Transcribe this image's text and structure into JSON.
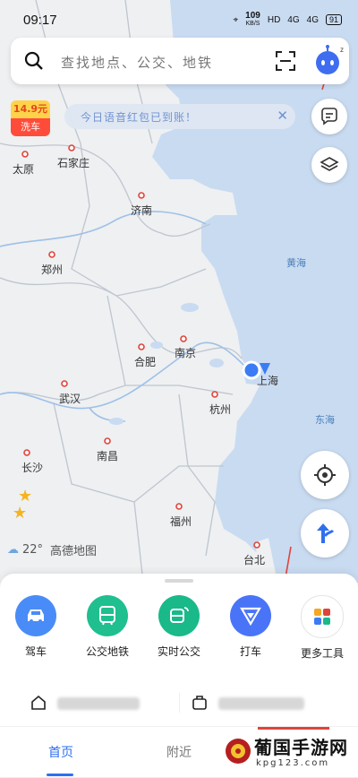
{
  "status_bar": {
    "time": "09:17",
    "net_speed_value": "109",
    "net_speed_unit": "KB/S",
    "hd": "HD",
    "sig1": "4G",
    "sig2": "4G",
    "battery": "91"
  },
  "search": {
    "placeholder": "查找地点、公交、地铁"
  },
  "promo": {
    "price": "14.9元",
    "label": "洗车"
  },
  "notice": {
    "text": "今日语音红包已到账！"
  },
  "map": {
    "cities": [
      {
        "name": "太原"
      },
      {
        "name": "石家庄"
      },
      {
        "name": "济南"
      },
      {
        "name": "郑州"
      },
      {
        "name": "合肥"
      },
      {
        "name": "南京"
      },
      {
        "name": "武汉"
      },
      {
        "name": "杭州"
      },
      {
        "name": "南昌"
      },
      {
        "name": "长沙"
      },
      {
        "name": "福州"
      },
      {
        "name": "台北"
      },
      {
        "name": "上海"
      }
    ],
    "seas": [
      {
        "name": "黄海"
      },
      {
        "name": "东海"
      }
    ],
    "weather": {
      "temp": "22°",
      "brand": "高德地图"
    }
  },
  "tools": [
    {
      "label": "驾车",
      "icon": "car-icon",
      "color": "#4a8cf7"
    },
    {
      "label": "公交地铁",
      "icon": "bus-icon",
      "color": "#1fbf8f"
    },
    {
      "label": "实时公交",
      "icon": "realtime-bus-icon",
      "color": "#19b98a"
    },
    {
      "label": "打车",
      "icon": "taxi-icon",
      "color": "#4a74f7"
    },
    {
      "label": "更多工具",
      "icon": "more-tools-icon",
      "color": "#ffffff"
    }
  ],
  "tabs": {
    "home": "首页",
    "nearby": "附近"
  },
  "watermark": {
    "name": "葡国手游网",
    "url": "kpg123.com"
  }
}
